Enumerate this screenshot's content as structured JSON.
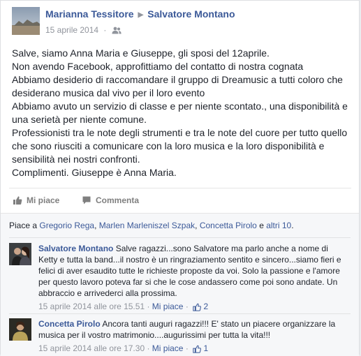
{
  "post": {
    "author": "Marianna Tessitore",
    "target": "Salvatore Montano",
    "date": "15 aprile 2014",
    "meta_separator": "·",
    "lines": [
      "Salve, siamo Anna Maria e Giuseppe, gli sposi del 12aprile.",
      "Non avendo Facebook, approfittiamo del contatto di nostra cognata",
      "Abbiamo desiderio di raccomandare il gruppo di Dreamusic a tutti coloro che desiderano musica dal vivo per il loro evento",
      "Abbiamo avuto un servizio di classe e per niente scontato., una disponibilità e una serietà per niente comune.",
      "Professionisti tra le note degli strumenti e tra le note del cuore per tutto quello che sono riusciti a comunicare con la loro musica e la loro disponibilità e sensibilità nei nostri confronti.",
      "Complimenti. Giuseppe è Anna Maria."
    ]
  },
  "actions": {
    "like": "Mi piace",
    "comment": "Commenta"
  },
  "likes": {
    "prefix": "Piace a ",
    "people": [
      "Gregorio Rega",
      "Marlen Marleniszel Szpak",
      "Concetta Pirolo"
    ],
    "comma": ", ",
    "and": " e ",
    "others": "altri 10",
    "suffix": "."
  },
  "comments": [
    {
      "author": "Salvatore Montano",
      "text": " Salve ragazzi...sono Salvatore ma parlo anche a nome di Ketty e tutta la band...il nostro è un ringraziamento sentito e sincero...siamo fieri e felici di aver esaudito tutte le richieste proposte da voi. Solo la passione e l'amore per questo lavoro poteva far si che le cose andassero come poi sono andate. Un abbraccio e arrivederci alla prossima.",
      "date": "15 aprile 2014 alle ore 15.51",
      "sep": " · ",
      "like": "Mi piace",
      "sep2": " · ",
      "likes": "2"
    },
    {
      "author": "Concetta Pirolo",
      "text": " Ancora tanti auguri ragazzi!!! E' stato un piacere organizzare la musica per il vostro matrimonio....augurissimi per tutta la vita!!!",
      "date": "15 aprile 2014 alle ore 17.30",
      "sep": " · ",
      "like": "Mi piace",
      "sep2": " · ",
      "likes": "1"
    }
  ],
  "icons": {
    "friends": "friends-audience-icon",
    "like": "thumbs-up-icon",
    "comment": "speech-bubble-icon",
    "arrow": "triangle-right-icon"
  },
  "colors": {
    "link": "#3b5998",
    "muted": "#90949c",
    "background": "#e9ebee"
  }
}
